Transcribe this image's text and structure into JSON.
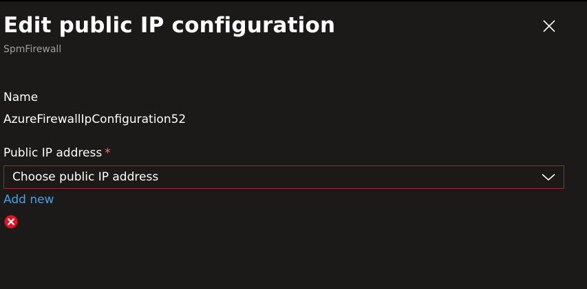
{
  "panel": {
    "title": "Edit public IP configuration",
    "subtitle": "SpmFirewall",
    "close_icon": "close-icon"
  },
  "form": {
    "name": {
      "label": "Name",
      "value": "AzureFirewallIpConfiguration52"
    },
    "public_ip": {
      "label": "Public IP address",
      "required_marker": "*",
      "placeholder": "Choose public IP address",
      "selected_value": "",
      "dropdown_icon": "chevron-down-icon",
      "add_new_link": "Add new",
      "validation_icon": "error-icon"
    }
  },
  "colors": {
    "background": "#1b1a19",
    "text": "#ffffff",
    "subtitle": "#a19f9d",
    "required": "#f1707b",
    "error_border": "#a4262c",
    "link": "#4aa0e6",
    "error_icon": "#e81123"
  }
}
